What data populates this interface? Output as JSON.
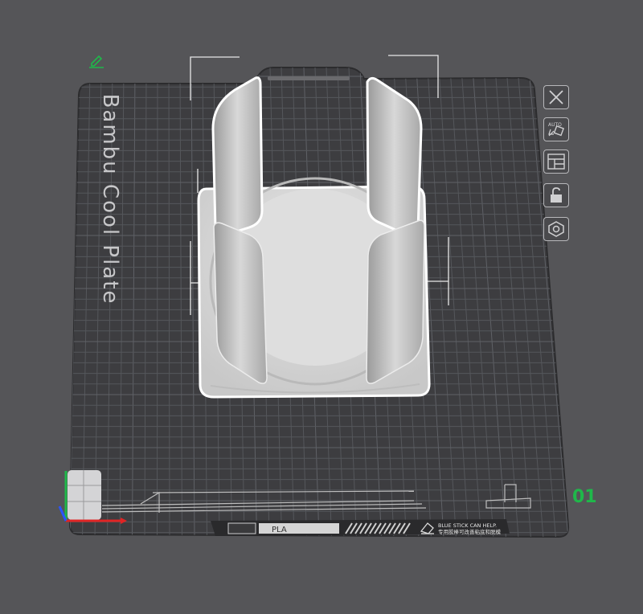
{
  "plate": {
    "name": "Bambu Cool Plate",
    "number": "01",
    "filament_label": "PLA",
    "glue_line1": "BLUE STICK CAN HELP.",
    "glue_line2": "专用胶棒可改善粘底和脱模"
  },
  "toolbar": {
    "items": [
      {
        "name": "close-icon"
      },
      {
        "name": "auto-orient-icon"
      },
      {
        "name": "arrange-icon"
      },
      {
        "name": "lock-icon"
      },
      {
        "name": "plate-settings-icon"
      }
    ]
  },
  "colors": {
    "background": "#555558",
    "plate": "#3d3d40",
    "grid": "#54565a",
    "model": "#d9d9d9",
    "selection": "#ffffff",
    "plate_number": "#1fb84a",
    "axis_x": "#e02424",
    "axis_y": "#1fb84a",
    "axis_z": "#2a55ff"
  }
}
